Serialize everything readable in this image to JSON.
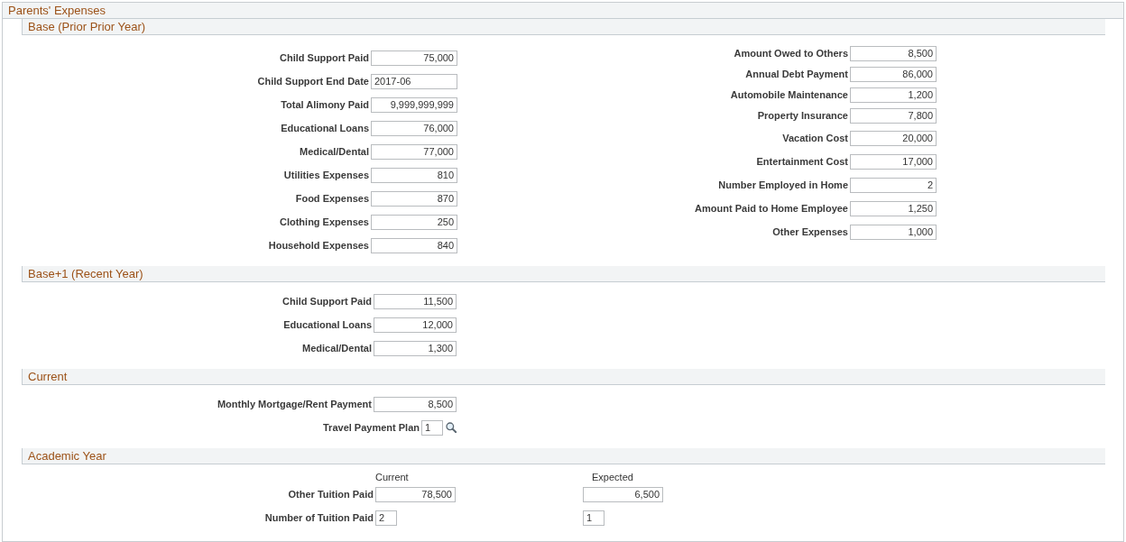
{
  "panel": {
    "title": "Parents' Expenses"
  },
  "sections": [
    {
      "title": "Base (Prior Prior Year)",
      "kind": "form",
      "columns": [
        [
          {
            "label": "Child Support Paid",
            "kind": "amount",
            "value": "75,000"
          },
          {
            "label": "Child Support End Date",
            "kind": "date",
            "value": "2017-06"
          },
          {
            "label": "Total Alimony Paid",
            "kind": "amount",
            "value": "9,999,999,999"
          },
          {
            "label": "Educational Loans",
            "kind": "amount",
            "value": "76,000"
          },
          {
            "label": "Medical/Dental",
            "kind": "amount",
            "value": "77,000"
          },
          {
            "label": "Utilities Expenses",
            "kind": "amount",
            "value": "810"
          },
          {
            "label": "Food Expenses",
            "kind": "amount",
            "value": "870"
          },
          {
            "label": "Clothing Expenses",
            "kind": "amount",
            "value": "250"
          },
          {
            "label": "Household Expenses",
            "kind": "amount",
            "value": "840"
          }
        ],
        [
          {
            "label": "Amount Owed to Others",
            "kind": "amount",
            "value": "8,500"
          },
          {
            "label": "Annual Debt Payment",
            "kind": "amount",
            "value": "86,000"
          },
          {
            "label": "Automobile Maintenance",
            "kind": "amount",
            "value": "1,200"
          },
          {
            "label": "Property Insurance",
            "kind": "amount",
            "value": "7,800"
          },
          {
            "label": "Vacation Cost",
            "kind": "amount",
            "value": "20,000"
          },
          {
            "label": "Entertainment Cost",
            "kind": "amount",
            "value": "17,000"
          },
          {
            "label": "Number Employed in Home",
            "kind": "amount",
            "value": "2"
          },
          {
            "label": "Amount Paid to Home Employee",
            "kind": "amount",
            "value": "1,250"
          },
          {
            "label": "Other Expenses",
            "kind": "amount",
            "value": "1,000"
          }
        ]
      ]
    },
    {
      "title": "Base+1 (Recent Year)",
      "kind": "form",
      "columns": [
        [
          {
            "label": "Child Support Paid",
            "kind": "amount",
            "value": "11,500"
          },
          {
            "label": "Educational Loans",
            "kind": "amount",
            "value": "12,000"
          },
          {
            "label": "Medical/Dental",
            "kind": "amount",
            "value": "1,300"
          }
        ]
      ]
    },
    {
      "title": "Current",
      "kind": "form",
      "columns": [
        [
          {
            "label": "Monthly Mortgage/Rent Payment",
            "kind": "amount",
            "value": "8,500"
          },
          {
            "label": "Travel Payment Plan",
            "kind": "lookup",
            "value": "1"
          }
        ]
      ]
    },
    {
      "title": "Academic Year",
      "kind": "grid",
      "column_headings": [
        "Current",
        "Expected"
      ],
      "rows": [
        {
          "label": "Other Tuition Paid",
          "fields": [
            {
              "kind": "amount",
              "value": "78,500"
            },
            {
              "kind": "amount",
              "value": "6,500"
            }
          ]
        },
        {
          "label": "Number of Tuition Paid",
          "fields": [
            {
              "kind": "code",
              "value": "2"
            },
            {
              "kind": "code",
              "value": "1"
            }
          ]
        }
      ]
    }
  ]
}
